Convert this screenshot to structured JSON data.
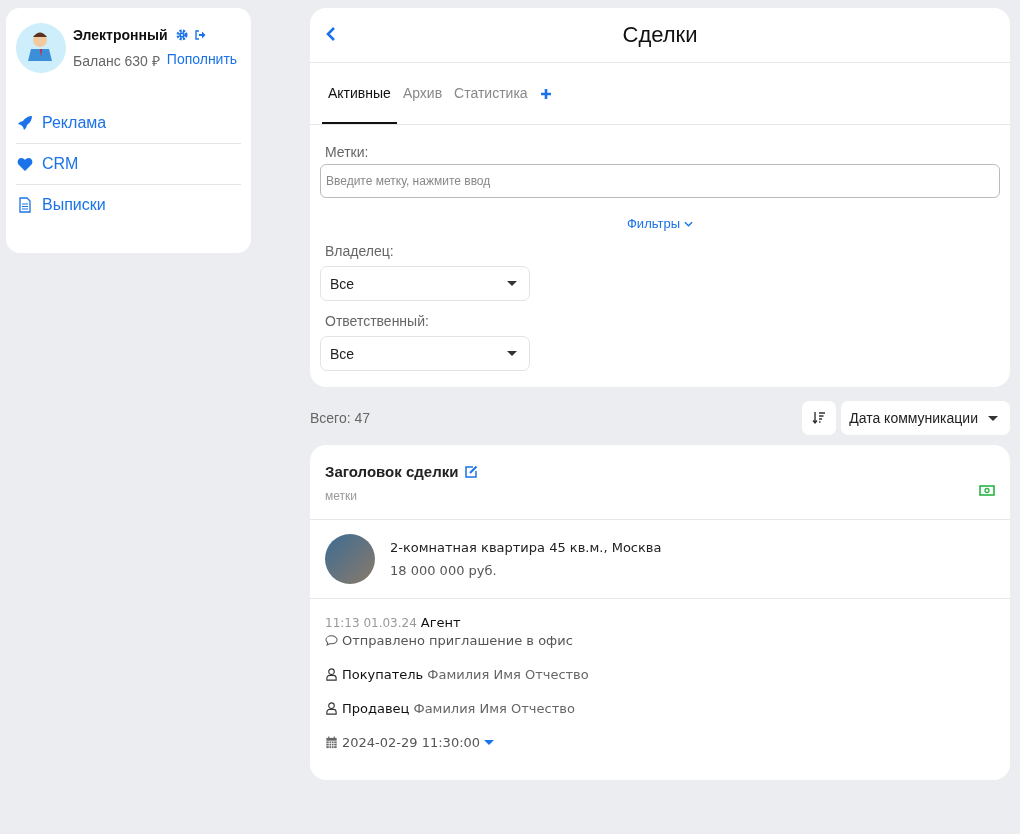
{
  "profile": {
    "name": "Электронный",
    "balance": "Баланс 630 ₽",
    "topup_link": "Пополнить"
  },
  "nav": [
    {
      "label": "Реклама"
    },
    {
      "label": "CRM"
    },
    {
      "label": "Выписки"
    }
  ],
  "header": {
    "title": "Сделки"
  },
  "tabs": [
    {
      "label": "Активные",
      "selected": true
    },
    {
      "label": "Архив",
      "selected": false
    },
    {
      "label": "Статистика",
      "selected": false
    }
  ],
  "tags": {
    "label": "Метки:",
    "placeholder": "Введите метку, нажмите ввод"
  },
  "filters_link": "Фильтры",
  "selects": [
    {
      "label": "Владелец:",
      "value": "Все"
    },
    {
      "label": "Ответственный:",
      "value": "Все"
    }
  ],
  "total": "Всего: 47",
  "sort": {
    "value": "Дата коммуникации"
  },
  "deal": {
    "title": "Заголовок сделки",
    "tags": "метки",
    "property": "2-комнатная квартира 45 кв.м., Москва",
    "price": "18 000 000 руб.",
    "time": "11:13 01.03.24",
    "author": "Агент",
    "message": "Отправлено приглашение в офис",
    "people": [
      {
        "role": "Покупатель",
        "name": "Фамилия Имя Отчество"
      },
      {
        "role": "Продавец",
        "name": "Фамилия Имя Отчество"
      }
    ],
    "date": "2024-02-29 11:30:00"
  }
}
